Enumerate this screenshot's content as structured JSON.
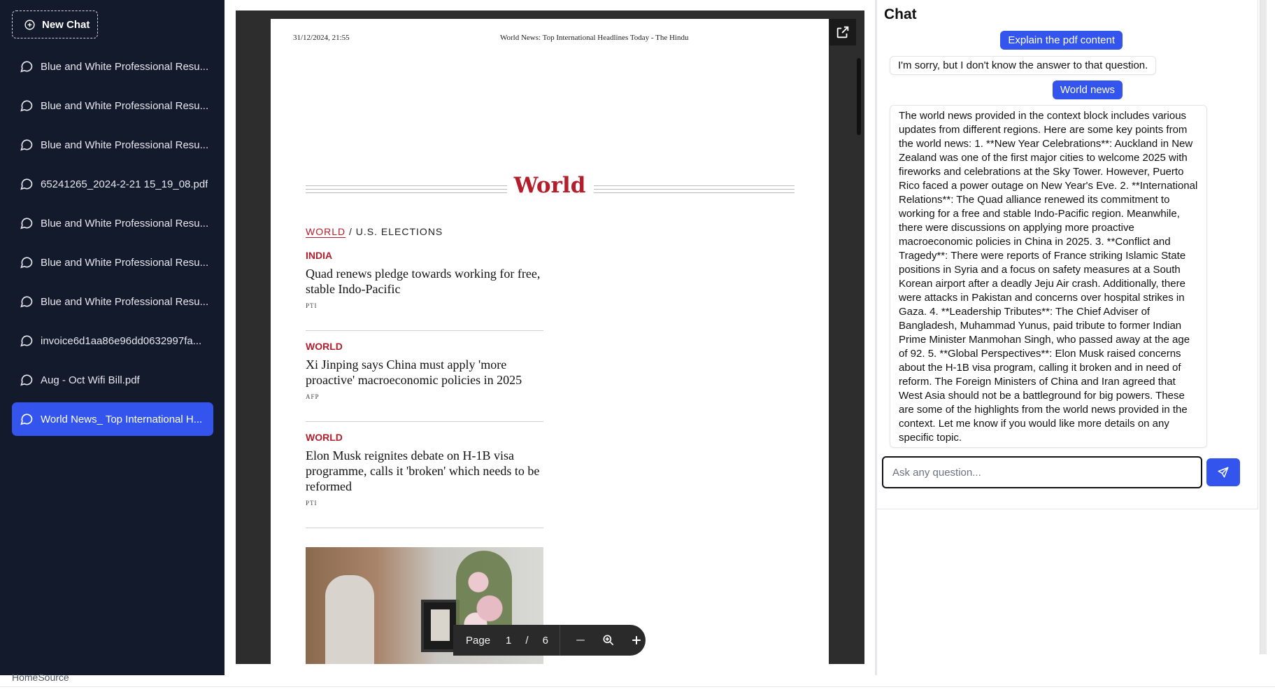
{
  "sidebar": {
    "new_chat_label": "New Chat",
    "items": [
      {
        "label": "Blue and White Professional Resu..."
      },
      {
        "label": "Blue and White Professional Resu..."
      },
      {
        "label": "Blue and White Professional Resu..."
      },
      {
        "label": "65241265_2024-2-21 15_19_08.pdf"
      },
      {
        "label": "Blue and White Professional Resu..."
      },
      {
        "label": "Blue and White Professional Resu..."
      },
      {
        "label": "Blue and White Professional Resu..."
      },
      {
        "label": "invoice6d1aa86e96dd0632997fa..."
      },
      {
        "label": "Aug - Oct Wifi Bill.pdf"
      },
      {
        "label": "World News_ Top International H..."
      }
    ],
    "active_index": 9
  },
  "footer": {
    "link": "HomeSource"
  },
  "pdf": {
    "header_date": "31/12/2024, 21:55",
    "header_title": "World News: Top International Headlines Today - The Hindu",
    "section_title": "World",
    "breadcrumb_1": "WORLD",
    "breadcrumb_sep": "/",
    "breadcrumb_2": "U.S. ELECTIONS",
    "articles": [
      {
        "category": "INDIA",
        "headline": "Quad renews pledge towards working for free, stable Indo-Pacific",
        "source": "PTI"
      },
      {
        "category": "WORLD",
        "headline": "Xi Jinping says China must apply 'more proactive' macroeconomic policies in 2025",
        "source": "AFP"
      },
      {
        "category": "WORLD",
        "headline": "Elon Musk reignites debate on H-1B visa programme, calls it 'broken' which needs to be reformed",
        "source": "PTI"
      }
    ],
    "toolbar": {
      "page_label": "Page",
      "current_page": "1",
      "separator": "/",
      "total_pages": "6"
    }
  },
  "chat": {
    "title": "Chat",
    "messages": [
      {
        "role": "user",
        "text": "Explain the pdf content"
      },
      {
        "role": "assistant",
        "text": "I'm sorry, but I don't know the answer to that question."
      },
      {
        "role": "user",
        "text": "World news"
      },
      {
        "role": "assistant",
        "text": "The world news provided in the context block includes various updates from different regions. Here are some key points from the world news: 1. **New Year Celebrations**: Auckland in New Zealand was one of the first major cities to welcome 2025 with fireworks and celebrations at the Sky Tower. However, Puerto Rico faced a power outage on New Year's Eve. 2. **International Relations**: The Quad alliance renewed its commitment to working for a free and stable Indo-Pacific region. Meanwhile, there were discussions on applying more proactive macroeconomic policies in China in 2025. 3. **Conflict and Tragedy**: There were reports of France striking Islamic State positions in Syria and a focus on safety measures at a South Korean airport after a deadly Jeju Air crash. Additionally, there were attacks in Pakistan and concerns over hospital strikes in Gaza. 4. **Leadership Tributes**: The Chief Adviser of Bangladesh, Muhammad Yunus, paid tribute to former Indian Prime Minister Manmohan Singh, who passed away at the age of 92. 5. **Global Perspectives**: Elon Musk raised concerns about the H-1B visa program, calling it broken and in need of reform. The Foreign Ministers of China and Iran agreed that West Asia should not be a battleground for big powers. These are some of the highlights from the world news provided in the context. Let me know if you would like more details on any specific topic."
      }
    ],
    "input_placeholder": "Ask any question...",
    "input_value": ""
  },
  "colors": {
    "accent": "#3355ee",
    "sidebar_bg": "#131a2b",
    "news_red": "#b51d2b",
    "viewer_bg": "#2d2d2d"
  },
  "icons": {
    "new_chat": "plus-circle-icon",
    "chat_item": "message-circle-icon",
    "open_external": "external-link-icon",
    "zoom_out": "minus-icon",
    "zoom": "zoom-in-icon",
    "zoom_in": "plus-icon",
    "send": "send-icon"
  }
}
